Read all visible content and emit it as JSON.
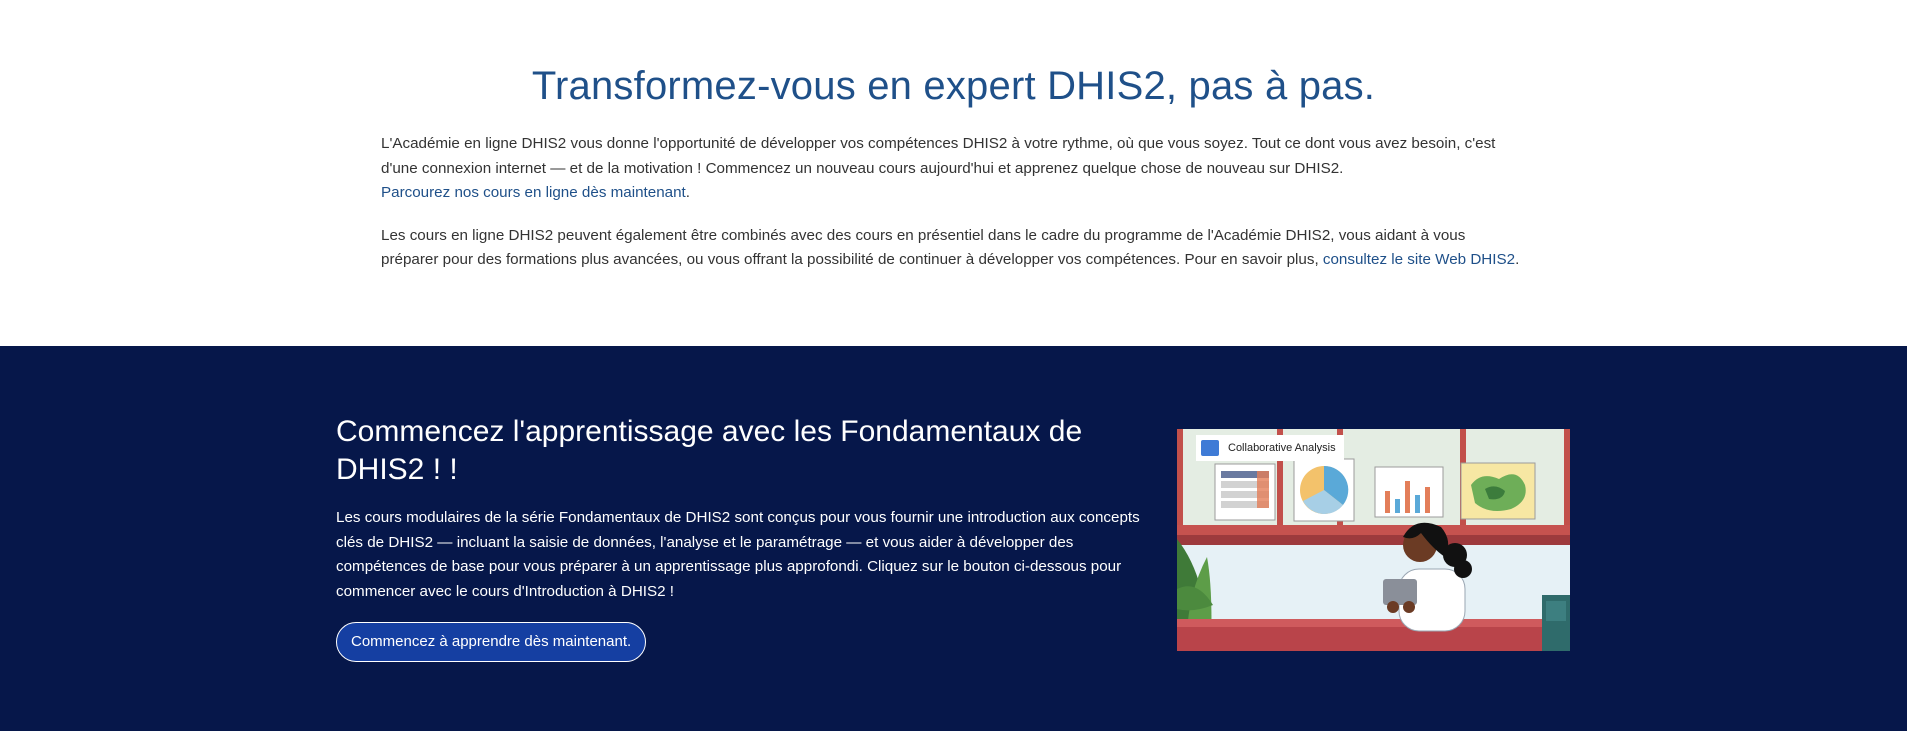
{
  "intro": {
    "title": "Transformez-vous en expert DHIS2, pas à pas.",
    "para1_text": "L'Académie en ligne DHIS2 vous donne l'opportunité de développer vos compétences DHIS2 à votre rythme, où que vous soyez. Tout ce dont vous avez besoin, c'est d'une connexion internet — et de la motivation ! Commencez un nouveau cours aujourd'hui et apprenez quelque chose de nouveau sur DHIS2.",
    "para1_link": "Parcourez nos cours en ligne dès maintenant",
    "para1_link_suffix": ".",
    "para2_text": "Les cours en ligne DHIS2 peuvent également être combinés avec des cours en présentiel dans le cadre du programme de l'Académie DHIS2, vous aidant à vous préparer pour des formations plus avancées, ou vous offrant la possibilité de continuer à développer vos compétences. Pour en savoir plus, ",
    "para2_link": "consultez le site Web DHIS2",
    "para2_link_suffix": "."
  },
  "fundamentals": {
    "title": "Commencez l'apprentissage avec les Fondamentaux de DHIS2 ! !",
    "description": "Les cours modulaires de la série Fondamentaux de DHIS2 sont conçus pour vous fournir une introduction aux concepts clés de DHIS2 — incluant la saisie de données, l'analyse et le paramétrage — et vous aider à développer des compétences de base pour vous préparer à un apprentissage plus approfondi. Cliquez sur le bouton ci-dessous pour commencer avec le cours d'Introduction à DHIS2 !",
    "button_label": "Commencez à apprendre dès maintenant.",
    "illustration_tag": "Collaborative Analysis"
  },
  "colors": {
    "heading_blue": "#1f5089",
    "navy_band": "#06174a",
    "button_blue": "#153fa2"
  }
}
